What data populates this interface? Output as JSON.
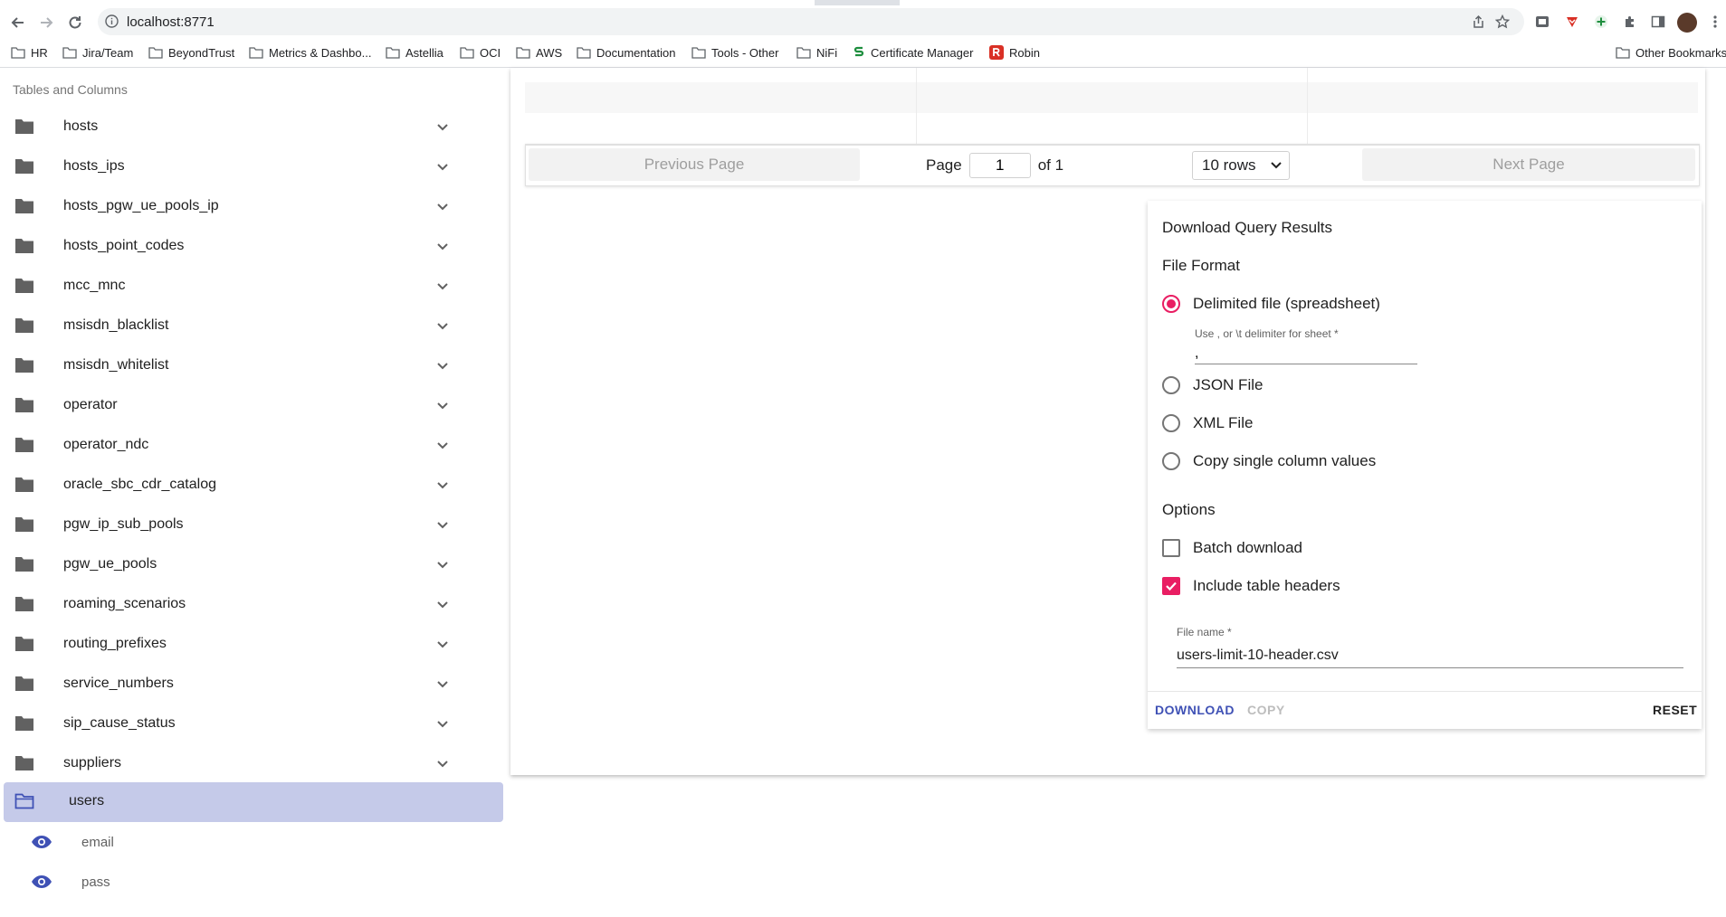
{
  "browser": {
    "url": "localhost:8771",
    "bookmarks": [
      "HR",
      "Jira/Team",
      "BeyondTrust",
      "Metrics & Dashbo...",
      "Astellia",
      "OCI",
      "AWS",
      "Documentation",
      "Tools - Other",
      "NiFi",
      "Certificate Manager",
      "Robin"
    ],
    "other_bookmarks": "Other Bookmarks"
  },
  "sidebar": {
    "title": "Tables and Columns",
    "tables": [
      "hosts",
      "hosts_ips",
      "hosts_pgw_ue_pools_ip",
      "hosts_point_codes",
      "mcc_mnc",
      "msisdn_blacklist",
      "msisdn_whitelist",
      "operator",
      "operator_ndc",
      "oracle_sbc_cdr_catalog",
      "pgw_ip_sub_pools",
      "pgw_ue_pools",
      "roaming_scenarios",
      "routing_prefixes",
      "service_numbers",
      "sip_cause_status",
      "suppliers"
    ],
    "selected_table": "users",
    "columns": [
      "email",
      "pass"
    ]
  },
  "pagination": {
    "previous_label": "Previous Page",
    "next_label": "Next Page",
    "page_label": "Page",
    "current_page": "1",
    "of_label": "of 1",
    "rows_value": "10 rows"
  },
  "download": {
    "title": "Download Query Results",
    "file_format_label": "File Format",
    "formats": [
      "Delimited file (spreadsheet)",
      "JSON File",
      "XML File",
      "Copy single column values"
    ],
    "selected_format": "Delimited file (spreadsheet)",
    "delimiter_label": "Use , or \\t delimiter for sheet *",
    "delimiter_value": ",",
    "options_label": "Options",
    "batch_download_label": "Batch download",
    "batch_download_checked": false,
    "include_headers_label": "Include table headers",
    "include_headers_checked": true,
    "file_name_label": "File name *",
    "file_name_value": "users-limit-10-header.csv",
    "download_button": "DOWNLOAD",
    "copy_button": "COPY",
    "reset_button": "RESET"
  },
  "colors": {
    "accent_pink": "#e91e63",
    "primary_indigo": "#3f51b5",
    "selected_row": "#c5cae9"
  }
}
